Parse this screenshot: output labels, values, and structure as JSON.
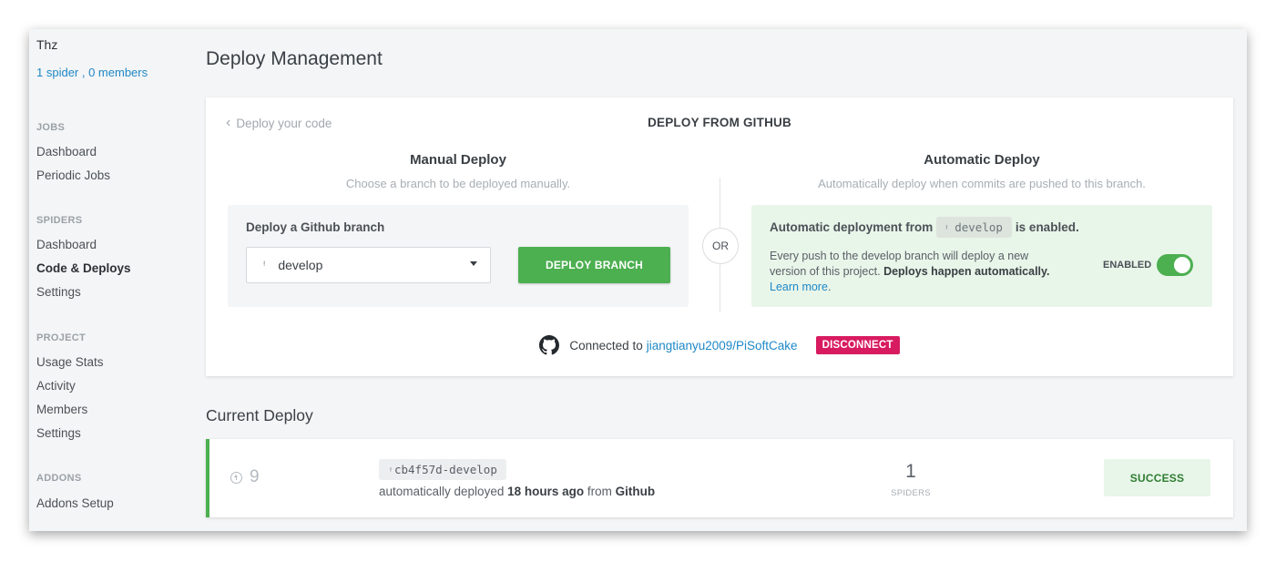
{
  "sidebar": {
    "org_name": "Thz",
    "org_meta": "1 spider , 0 members",
    "sections": [
      {
        "heading": "JOBS",
        "items": [
          "Dashboard",
          "Periodic Jobs"
        ]
      },
      {
        "heading": "SPIDERS",
        "items": [
          "Dashboard",
          "Code & Deploys",
          "Settings"
        ]
      },
      {
        "heading": "PROJECT",
        "items": [
          "Usage Stats",
          "Activity",
          "Members",
          "Settings"
        ]
      },
      {
        "heading": "ADDONS",
        "items": [
          "Addons Setup"
        ]
      }
    ],
    "active_item": "Code & Deploys"
  },
  "main": {
    "page_title": "Deploy Management",
    "card": {
      "back_link": "Deploy your code",
      "title": "DEPLOY FROM GITHUB",
      "manual": {
        "title": "Manual Deploy",
        "subtitle": "Choose a branch to be deployed manually.",
        "box_label": "Deploy a Github branch",
        "selected_branch": "develop",
        "button_label": "DEPLOY BRANCH"
      },
      "or_label": "OR",
      "automatic": {
        "title": "Automatic Deploy",
        "subtitle": "Automatically deploy when commits are pushed to this branch.",
        "line_prefix": "Automatic deployment from",
        "branch": "develop",
        "line_suffix": "is enabled.",
        "desc_part1": "Every push to the develop branch will deploy a new version of this project. ",
        "desc_bold": "Deploys happen automatically.",
        "learn_more": "Learn more",
        "learn_more_suffix": ".",
        "toggle_label": "ENABLED",
        "toggle_on": true
      },
      "connection": {
        "prefix": "Connected to",
        "repo": "jiangtianyu2009/PiSoftCake",
        "disconnect_label": "DISCONNECT"
      }
    },
    "current_deploy": {
      "section_title": "Current Deploy",
      "number": "9",
      "commit": "cb4f57d-develop",
      "info_prefix": "automatically deployed",
      "time": "18 hours ago",
      "info_mid": "from",
      "source": "Github",
      "spiders_count": "1",
      "spiders_label": "SPIDERS",
      "status": "SUCCESS"
    }
  },
  "colors": {
    "accent_green": "#4caf50",
    "link_blue": "#1e88c7",
    "danger_pink": "#d81b60",
    "success_bg": "#e8f5e9"
  },
  "icons": {
    "back": "chevron-left-icon",
    "branch": "git-branch-icon",
    "dropdown": "caret-down-icon",
    "github": "github-icon",
    "deploy_number": "arrow-up-circle-icon"
  }
}
